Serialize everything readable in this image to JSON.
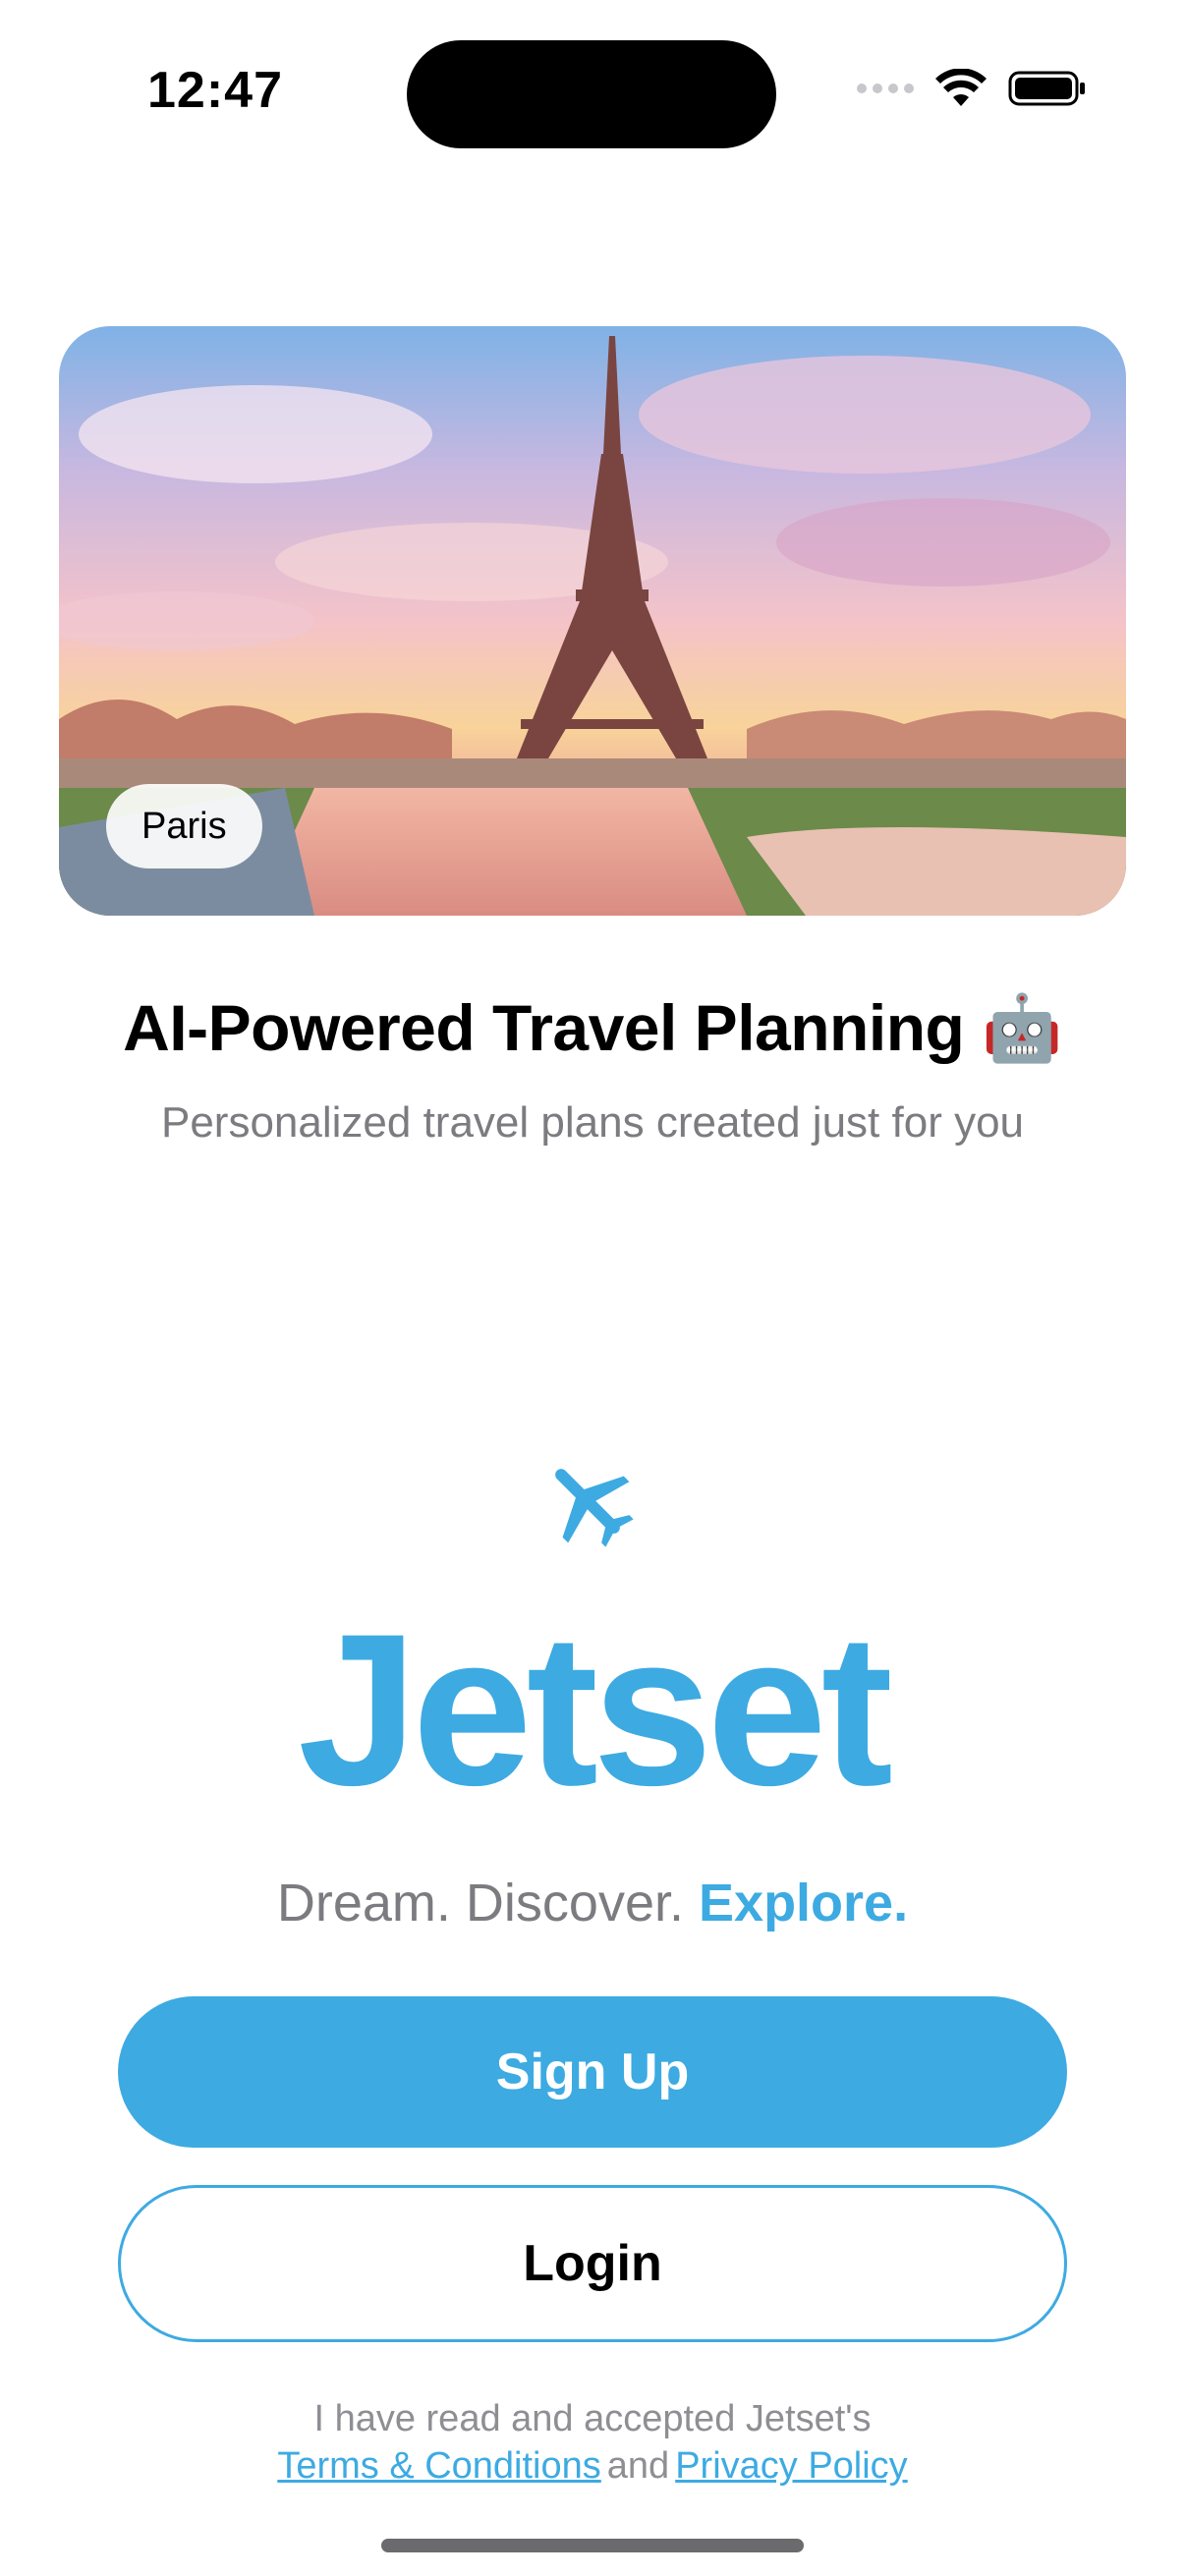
{
  "status_bar": {
    "time": "12:47"
  },
  "hero": {
    "city_label": "Paris",
    "image_subject": "eiffel-tower-sunset"
  },
  "headline": {
    "title": "AI-Powered Travel Planning 🤖",
    "subtitle": "Personalized travel plans created just for you"
  },
  "brand": {
    "icon": "airplane-icon",
    "name": "Jetset",
    "tagline_prefix": "Dream. Discover.",
    "tagline_accent": "Explore."
  },
  "actions": {
    "signup_label": "Sign Up",
    "login_label": "Login"
  },
  "legal": {
    "line1": "I have read and accepted Jetset's",
    "terms_link": "Terms & Conditions",
    "and_text": "and",
    "privacy_link": "Privacy Policy"
  },
  "colors": {
    "accent": "#3daae2",
    "muted_text": "#7b7b80"
  }
}
